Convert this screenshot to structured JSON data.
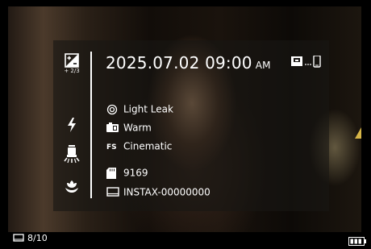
{
  "panel": {
    "exposure_compensation": "+ 2/3",
    "date": "2025.07.02",
    "time": "09:00",
    "ampm": "AM",
    "effect": "Light Leak",
    "filter": "Warm",
    "film_mode_tag": "FS",
    "film_mode": "Cinematic",
    "image_count": "9169",
    "device_name": "INSTAX-00000000"
  },
  "status_bar": {
    "shot_counter": "8/10"
  },
  "icons": [
    "exposure-compensation-icon",
    "flash-icon",
    "self-timer-icon",
    "macro-icon",
    "print-icon",
    "phone-icon",
    "effect-icon",
    "filter-icon",
    "memory-card-icon",
    "device-icon",
    "frame-icon",
    "battery-icon"
  ],
  "colors": {
    "overlay": "#191614",
    "text": "#ffffff",
    "warning": "#d6b548"
  }
}
